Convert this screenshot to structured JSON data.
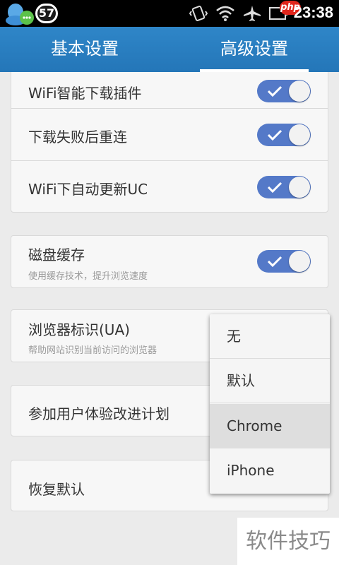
{
  "status_bar": {
    "badge": "57",
    "php_badge": "php",
    "time": "23:38",
    "icons": [
      "qq-icon",
      "vibrate-icon",
      "wifi-icon",
      "airplane-icon",
      "battery-icon"
    ]
  },
  "tabs": [
    {
      "label": "基本设置",
      "active": false
    },
    {
      "label": "高级设置",
      "active": true
    }
  ],
  "settings": {
    "wifi_plugin": "WiFi智能下载插件",
    "retry": "下载失败后重连",
    "auto_update": "WiFi下自动更新UC",
    "disk_cache": "磁盘缓存",
    "disk_cache_sub": "使用缓存技术，提升浏览速度",
    "ua": "浏览器标识(UA)",
    "ua_sub": "帮助网站识别当前访问的浏览器",
    "ux_plan": "参加用户体验改进计划",
    "restore": "恢复默认"
  },
  "toggles": {
    "wifi_plugin": true,
    "retry": true,
    "auto_update": true,
    "disk_cache": true
  },
  "ua_options": [
    "无",
    "默认",
    "Chrome",
    "iPhone"
  ],
  "ua_selected": "Chrome",
  "watermark": "软件技巧",
  "colors": {
    "accent": "#2f86c8",
    "toggle_on": "#5479c8"
  }
}
